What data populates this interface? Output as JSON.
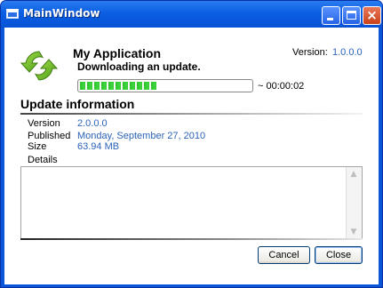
{
  "window": {
    "title": "MainWindow"
  },
  "header": {
    "app_name": "My Application",
    "status": "Downloading an update.",
    "version_label": "Version:",
    "version_value": "1.0.0.0"
  },
  "progress": {
    "fraction": 0.45,
    "eta": "~ 00:00:02",
    "color": "#2ec22e"
  },
  "update_info": {
    "title": "Update information",
    "fields": [
      {
        "label": "Version",
        "value": "2.0.0.0"
      },
      {
        "label": "Published",
        "value": "Monday, September 27, 2010"
      },
      {
        "label": "Size",
        "value": "63.94 MB"
      },
      {
        "label": "Details",
        "value": ""
      }
    ]
  },
  "buttons": {
    "cancel": "Cancel",
    "close": "Close"
  },
  "colors": {
    "accent": "#2b63b8",
    "titlebar": "#0b5ee3"
  }
}
